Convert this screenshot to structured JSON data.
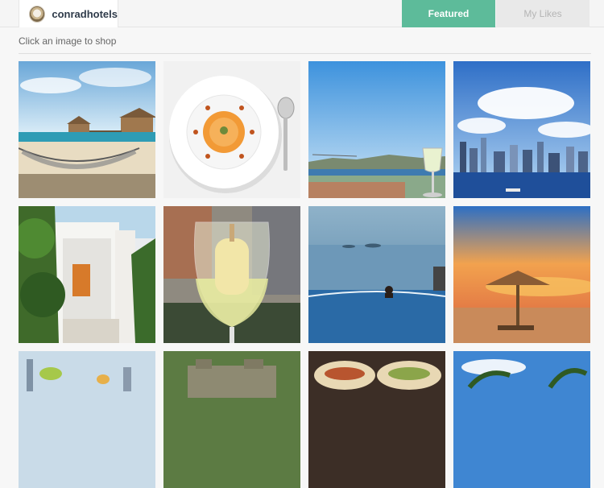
{
  "account": {
    "username": "conradhotels"
  },
  "tabs": {
    "featured": "Featured",
    "my_likes": "My Likes"
  },
  "hint": "Click an image to shop",
  "colors": {
    "featured_tab": "#5dbb9a",
    "inactive_tab": "#e9e9e9"
  },
  "grid": [
    {
      "name": "photo-beach-hammock-overwater-villas"
    },
    {
      "name": "photo-soup-plate-with-spoon"
    },
    {
      "name": "photo-bosphorus-view-wine-glass"
    },
    {
      "name": "photo-city-skyline-harbor"
    },
    {
      "name": "photo-white-villa-orange-door"
    },
    {
      "name": "photo-popsicle-in-wine-glass"
    },
    {
      "name": "photo-infinity-pool-swimmer"
    },
    {
      "name": "photo-sunset-beach-umbrella"
    },
    {
      "name": "photo-cocktail-drinks-skyline"
    },
    {
      "name": "photo-stone-ruins-jungle"
    },
    {
      "name": "photo-tacos-plate"
    },
    {
      "name": "photo-palm-trees-sky"
    }
  ]
}
